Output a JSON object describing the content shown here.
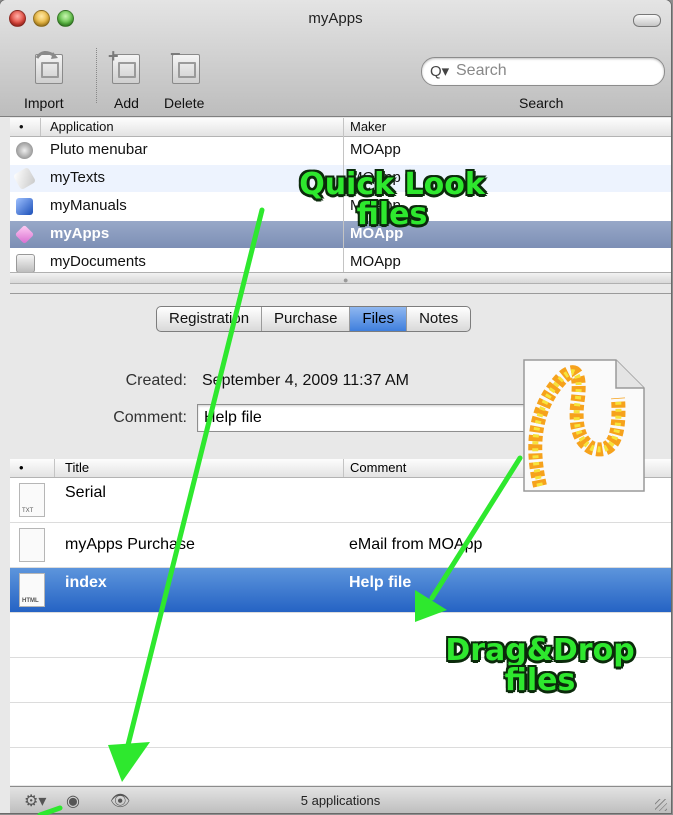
{
  "window": {
    "title": "myApps"
  },
  "toolbar": {
    "import_label": "Import",
    "add_label": "Add",
    "delete_label": "Delete",
    "search_placeholder": "Search",
    "search_label": "Search"
  },
  "apps_table": {
    "columns": {
      "bullet": "•",
      "application": "Application",
      "maker": "Maker"
    },
    "rows": [
      {
        "name": "Pluto menubar",
        "maker": "MOApp",
        "icon": "pluto-icon"
      },
      {
        "name": "myTexts",
        "maker": "MOApp",
        "icon": "mytexts-icon"
      },
      {
        "name": "myManuals",
        "maker": "MOApp",
        "icon": "mymanuals-icon"
      },
      {
        "name": "myApps",
        "maker": "MOApp",
        "icon": "myapps-icon"
      },
      {
        "name": "myDocuments",
        "maker": "MOApp",
        "icon": "mydocuments-icon"
      }
    ]
  },
  "detail": {
    "tabs": [
      "Registration",
      "Purchase",
      "Files",
      "Notes"
    ],
    "active_tab": "Files",
    "created_label": "Created:",
    "created_value": "September 4, 2009 11:37 AM",
    "comment_label": "Comment:",
    "comment_value": "Help file"
  },
  "files_table": {
    "columns": {
      "bullet": "•",
      "title": "Title",
      "comment": "Comment"
    },
    "rows": [
      {
        "title": "Serial",
        "comment": "",
        "type": "TXT"
      },
      {
        "title": "myApps Purchase",
        "comment": "eMail from MOApp",
        "type": ""
      },
      {
        "title": "index",
        "comment": "Help file",
        "type": "HTML"
      }
    ]
  },
  "statusbar": {
    "text": "5 applications"
  },
  "annotations": {
    "quicklook_line1": "Quick Look",
    "quicklook_line2": "files",
    "dragdrop_line1": "Drag&Drop",
    "dragdrop_line2": "files"
  },
  "colors": {
    "annotation": "#2ee82e",
    "selection_blue": "#2563c4",
    "selection_grey": "#7d8fb5"
  }
}
